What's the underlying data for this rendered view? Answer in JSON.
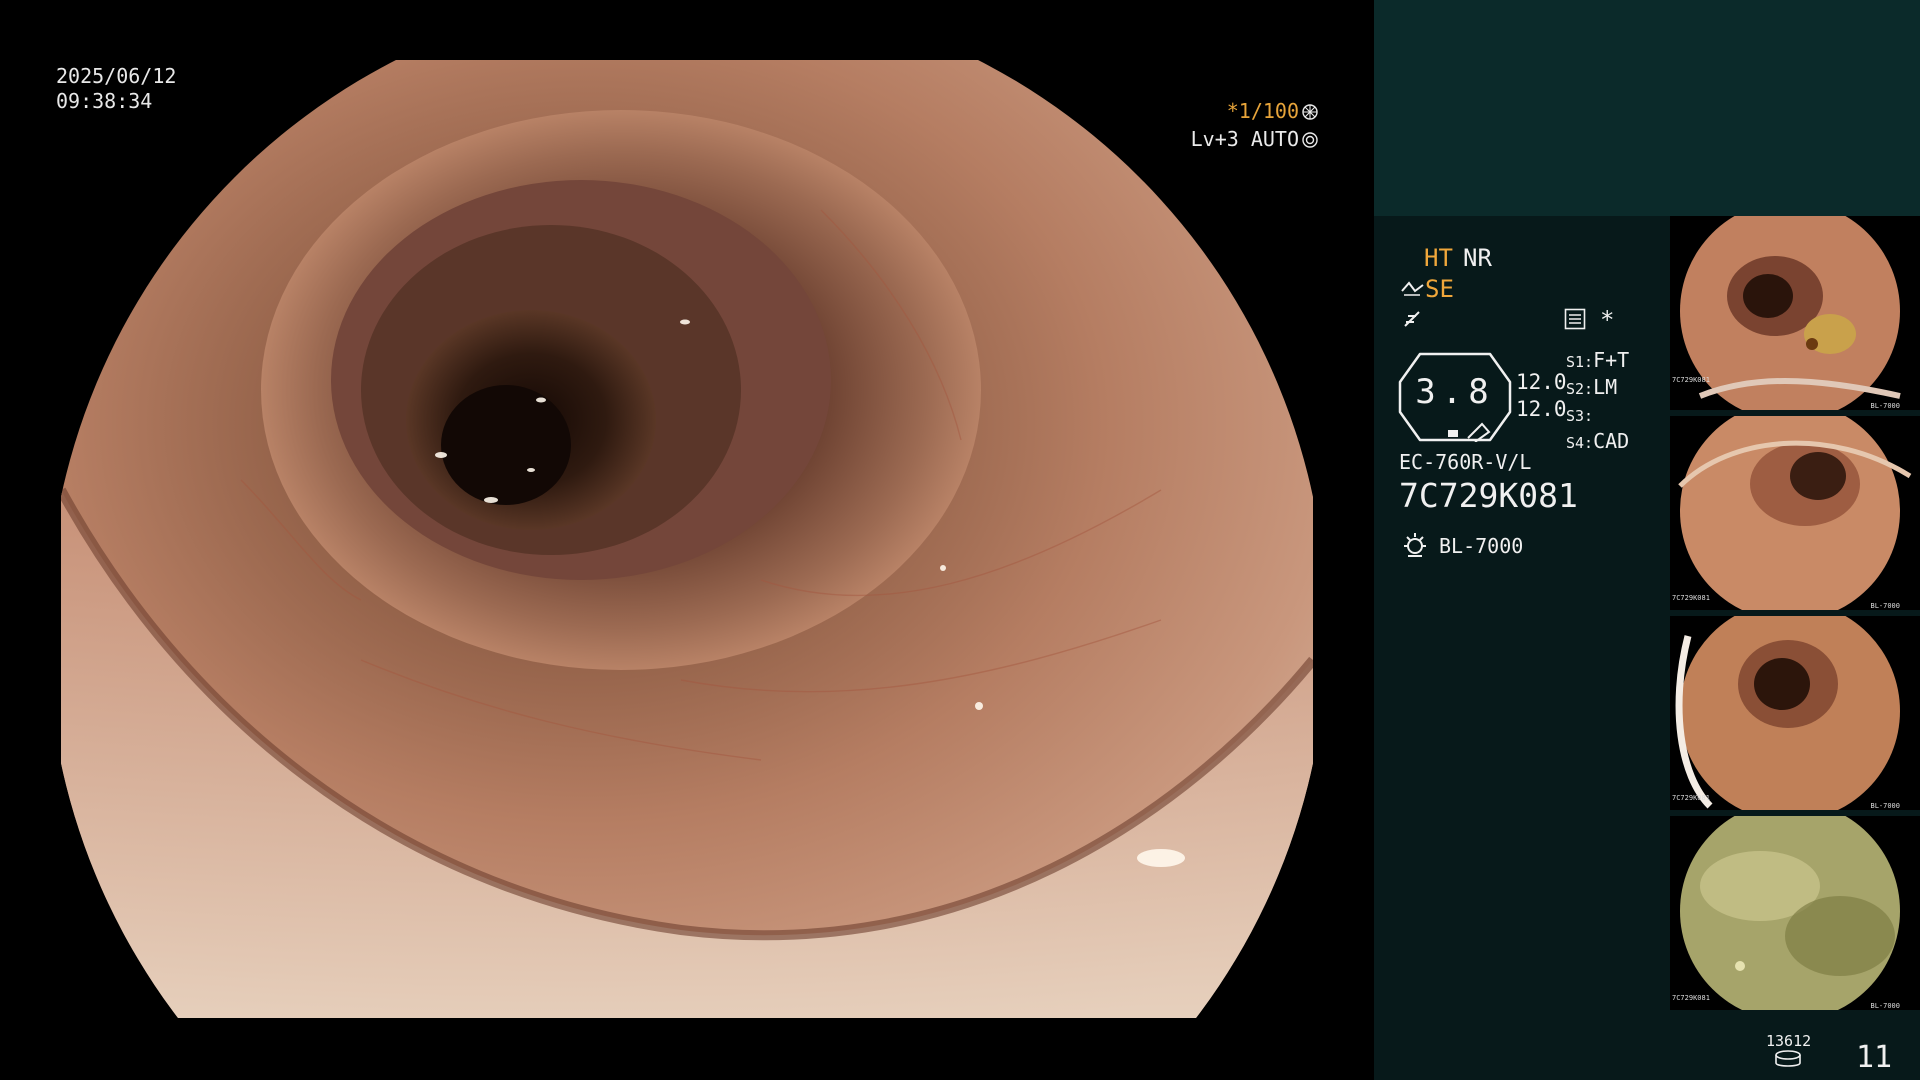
{
  "overlay": {
    "date": "2025/06/12",
    "time": "09:38:34",
    "shutter": "*1/100",
    "level": "Lv+3 AUTO"
  },
  "panel": {
    "mode_ht": "HT",
    "mode_nr": "NR",
    "mode_se": "SE",
    "zoom_value": "3.8",
    "value_a": "12.0",
    "value_b": "12.0",
    "s1": "S1:",
    "s1_val": "F+T",
    "s2": "S2:",
    "s2_val": "LM",
    "s3": "S3:",
    "s3_val": "",
    "s4": "S4:",
    "s4_val": "CAD",
    "scope_model": "EC-760R-V/L",
    "serial": "7C729K081",
    "light_source": "BL-7000",
    "image_count": "13612",
    "page_number": "11"
  },
  "thumbnails": [
    {
      "serial": "7C729K081",
      "source": "BL-7000"
    },
    {
      "serial": "7C729K081",
      "source": "BL-7000"
    },
    {
      "serial": "7C729K081",
      "source": "BL-7000"
    },
    {
      "serial": "7C729K081",
      "source": "BL-7000"
    }
  ],
  "colors": {
    "accent": "#f0a73b",
    "panel_bg": "#07191a",
    "panel_top": "#0b2a2a"
  }
}
